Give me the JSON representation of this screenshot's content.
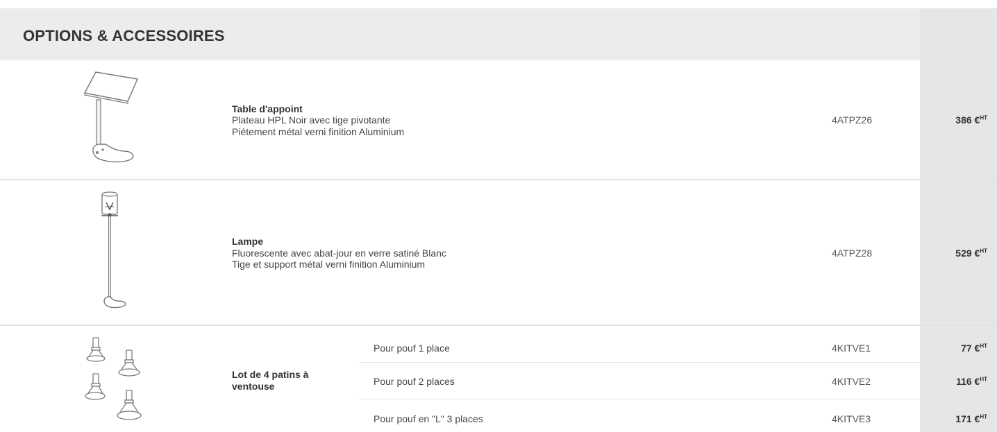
{
  "header": {
    "title": "OPTIONS & ACCESSOIRES"
  },
  "products": [
    {
      "name": "Table d'appoint",
      "line1": "Plateau HPL Noir avec tige pivotante",
      "line2": "Piétement métal verni finition Aluminium",
      "ref": "4ATPZ26",
      "price": "386 €",
      "price_suffix": "HT",
      "icon": "side-table-icon"
    },
    {
      "name": "Lampe",
      "line1": "Fluorescente avec abat-jour en verre satiné Blanc",
      "line2": "Tige et support métal verni finition Aluminium",
      "ref": "4ATPZ28",
      "price": "529 €",
      "price_suffix": "HT",
      "icon": "floor-lamp-icon"
    },
    {
      "name": "Lot de 4 patins à ventouse",
      "icon": "suction-pads-icon",
      "variants": [
        {
          "label": "Pour pouf 1 place",
          "ref": "4KITVE1",
          "price": "77 €",
          "price_suffix": "HT"
        },
        {
          "label": "Pour pouf 2 places",
          "ref": "4KITVE2",
          "price": "116 €",
          "price_suffix": "HT"
        },
        {
          "label": "Pour pouf en \"L\" 3 places",
          "ref": "4KITVE3",
          "price": "171 €",
          "price_suffix": "HT"
        }
      ]
    }
  ]
}
